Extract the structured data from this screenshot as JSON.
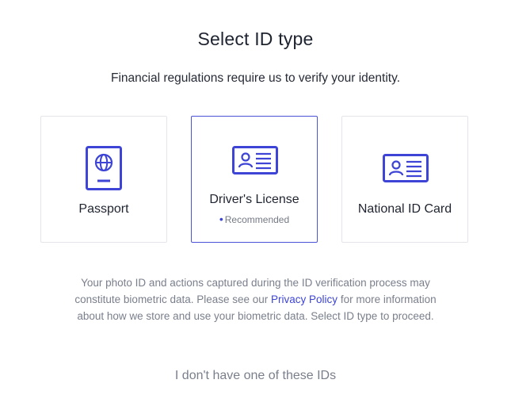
{
  "header": {
    "title": "Select ID type",
    "subtitle": "Financial regulations require us to verify your identity."
  },
  "cards": [
    {
      "label": "Passport",
      "icon": "passport-icon",
      "selected": false
    },
    {
      "label": "Driver's License",
      "icon": "id-card-icon",
      "selected": true,
      "badge": "Recommended"
    },
    {
      "label": "National ID Card",
      "icon": "id-card-icon",
      "selected": false
    }
  ],
  "disclaimer": {
    "before": "Your photo ID and actions captured during the ID verification process may constitute biometric data. Please see our ",
    "link": "Privacy Policy",
    "after": " for more information about how we store and use your biometric data. Select ID type to proceed."
  },
  "footer": {
    "no_id_link": "I don't have one of these IDs"
  },
  "colors": {
    "accent": "#3d44d6",
    "selected_border": "#4a52d8",
    "card_border": "#e3e5ea",
    "muted_text": "#7a7f8c"
  }
}
